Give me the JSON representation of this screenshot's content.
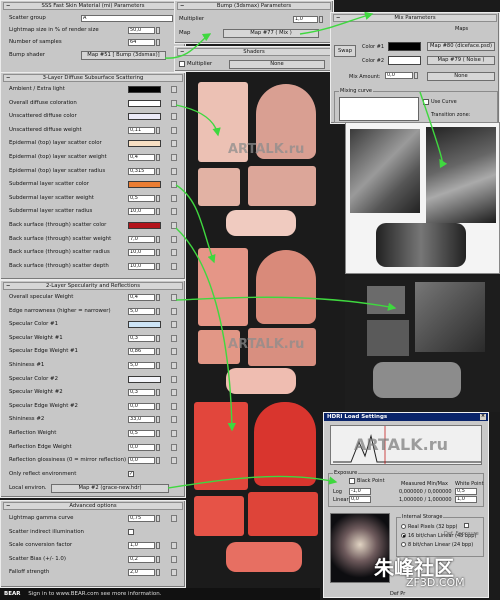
{
  "sss_panel": {
    "title": "SSS Fast Skin Material (mi) Parameters",
    "rows": [
      {
        "label": "Scatter group",
        "value": "A"
      },
      {
        "label": "Lightmap size in % of render size",
        "value": "50,0"
      },
      {
        "label": "Number of samples",
        "value": "64"
      }
    ],
    "bump_label": "Bump shader",
    "bump_map": "Map #51  [ Bump (3dsmax)]"
  },
  "diffuse_panel": {
    "title": "3-Layer Diffuse Subsurface Scattering",
    "rows": [
      {
        "label": "Ambient / Extra light",
        "value": "",
        "color": "#000000"
      },
      {
        "label": "Overall diffuse coloration",
        "value": "",
        "color": "#ffffff"
      },
      {
        "label": "Unscattered diffuse color",
        "value": "",
        "color": "#ecebf8"
      },
      {
        "label": "Unscattered diffuse weight",
        "value": "0,11"
      },
      {
        "label": "Epidermal (top) layer scatter color",
        "value": "",
        "color": "#f8e0c4"
      },
      {
        "label": "Epidermal (top) layer scatter weight",
        "value": "0,4"
      },
      {
        "label": "Epidermal (top) layer scatter radius",
        "value": "0,315"
      },
      {
        "label": "Subdermal layer scatter color",
        "value": "",
        "color": "#ea7d33"
      },
      {
        "label": "Subdermal layer scatter weight",
        "value": "0,5"
      },
      {
        "label": "Subdermal layer scatter radius",
        "value": "10,0"
      },
      {
        "label": "Back surface (through) scatter color",
        "value": "",
        "color": "#b3141b"
      },
      {
        "label": "Back surface (through) scatter weight",
        "value": "7,0"
      },
      {
        "label": "Back surface (through) scatter radius",
        "value": "10,0"
      },
      {
        "label": "Back surface (through) scatter depth",
        "value": "10,0"
      }
    ]
  },
  "specular_panel": {
    "title": "2-Layer Specularity and Reflections",
    "rows": [
      {
        "label": "Overall specular Weight",
        "value": "0,4"
      },
      {
        "label": "Edge narrowness (higher = narrower)",
        "value": "5,0"
      },
      {
        "label": "Specular Color #1",
        "value": "",
        "color": "#cde4f6"
      },
      {
        "label": "Specular Weight #1",
        "value": "0,3"
      },
      {
        "label": "Specular Edge Weight #1",
        "value": "0,86"
      },
      {
        "label": "Shininess #1",
        "value": "5,0"
      },
      {
        "label": "Specular Color #2",
        "value": "",
        "color": "#f4f5fa"
      },
      {
        "label": "Specular Weight #2",
        "value": "0,3"
      },
      {
        "label": "Specular Edge Weight #2",
        "value": "0,0"
      },
      {
        "label": "Shininess #2",
        "value": "33,0"
      },
      {
        "label": "Reflection Weight",
        "value": "0,5"
      },
      {
        "label": "Reflection Edge Weight",
        "value": "0,0"
      },
      {
        "label": "Reflection glossiness (0 = mirror reflection)",
        "value": "0,0"
      },
      {
        "label": "Only reflect environment",
        "value": "✓"
      }
    ],
    "env_label": "Local environ.",
    "env_map": "Map #2  (grace-new.hdr)"
  },
  "advanced_panel": {
    "title": "Advanced options",
    "rows": [
      {
        "label": "Lightmap gamma curve",
        "value": "0,75"
      },
      {
        "label": "Scatter indirect illumination",
        "value": ""
      },
      {
        "label": "Scale conversion factor",
        "value": "1,0"
      },
      {
        "label": "Scatter Bias (+/- 1.0)",
        "value": "0,2"
      },
      {
        "label": "Falloff strength",
        "value": "2,0"
      }
    ]
  },
  "bump_panel": {
    "title": "Bump (3dsmax) Parameters",
    "multiplier_label": "Multiplier",
    "multiplier_value": "1,0",
    "map_label": "Map",
    "map_value": "Map #77  ( Mix )"
  },
  "shaders_panel": {
    "title": "Shaders",
    "multiplier_label": "Multiplier",
    "none_label": "None"
  },
  "mix_panel": {
    "title": "Mix Parameters",
    "maps_header": "Maps",
    "swap_label": "Swap",
    "color1_label": "Color #1",
    "color1_map": "Map #80 (diceface.psd)",
    "color2_label": "Color #2",
    "color2_map": "Map #79  ( Noise )",
    "mix_amount_label": "Mix Amount:",
    "mix_amount_value": "0,0",
    "mix_none": "None",
    "mixing_curve_label": "Mixing curve",
    "use_curve_label": "Use Curve",
    "transition_label": "Transition zone:"
  },
  "watermarks": {
    "main": "ARTALK.ru",
    "hdri": "ARTALK.ru"
  },
  "hdri_dialog": {
    "title": "HDRI Load Settings",
    "exposure_label": "Exposure",
    "black_point_label": "Black Point",
    "measured_label": "Measured Min/Max",
    "white_point_label": "White Point",
    "log_label": "Log",
    "linear_label": "Linear",
    "log_value": "-1,0",
    "linear_value": "0,0",
    "measured_top": "0,000000 / 0,000000",
    "measured_bottom": "1,000000 / 1,000000",
    "white_top": "0,5",
    "white_bottom": "1,0",
    "internal_storage_label": "Internal Storage",
    "storage_options": [
      {
        "label": "Real Pixels (32 bpp)",
        "selected": false
      },
      {
        "label": "16 bit/chan Linear (48 bpp)",
        "selected": true
      },
      {
        "label": "8 bit/chan Linear (24 bpp)",
        "selected": false
      }
    ],
    "def_exposure_label": "Def. Exposure",
    "preview_hint": "Def Pr"
  },
  "footer": {
    "brand": "BEAR",
    "text": "Sign in to www.BEAR.com see more information."
  },
  "corner_watermark": {
    "main": "朱峰社区",
    "sub": "ZF3D.COM"
  },
  "colors": {
    "panel_bg": "#c7c7c7",
    "arrow_green": "#3fd83f",
    "title_blue": "#0a246a"
  }
}
